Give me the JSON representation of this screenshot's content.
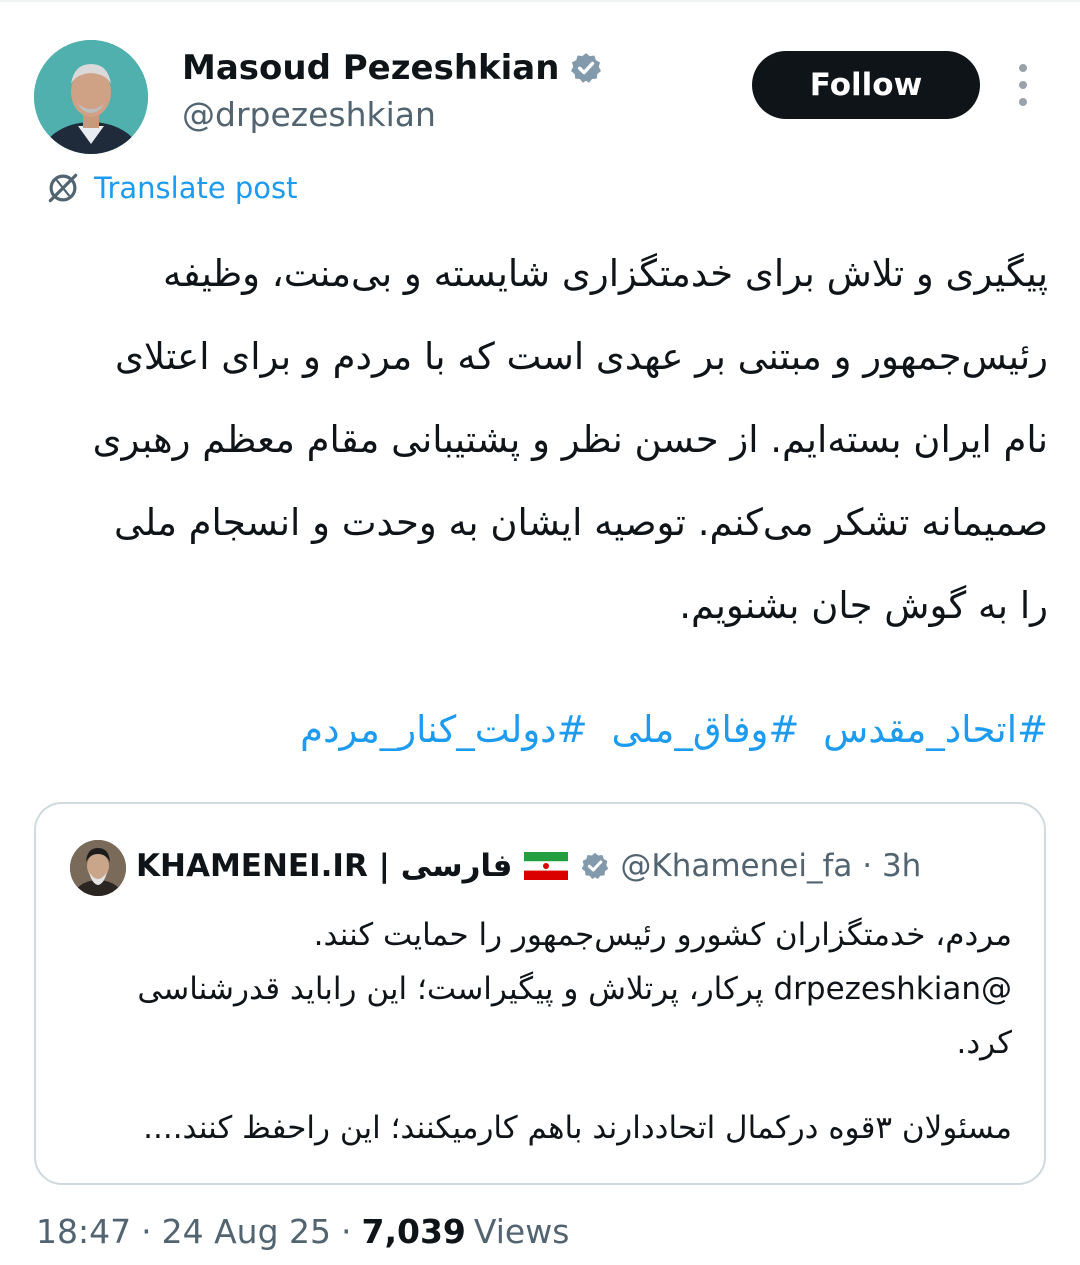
{
  "author": {
    "display_name": "Masoud Pezeshkian",
    "handle": "@drpezeshkian",
    "verified_icon": "verified-badge-icon"
  },
  "actions": {
    "follow_label": "Follow",
    "more_icon": "more-vertical-icon"
  },
  "translate": {
    "label": "Translate post",
    "icon": "translate-globe-icon"
  },
  "post": {
    "lines": [
      "پیگیری و تلاش برای خدمتگزاری شایسته و بی‌منت، وظیفه",
      "رئیس‌جمهور و مبتنی بر عهدی است که با مردم و برای اعتلای",
      "نام ایران بسته‌ایم. از حسن نظر و پشتیبانی مقام معظم رهبری",
      "صمیمانه تشکر می‌کنم. توصیه ایشان به وحدت و انسجام ملی",
      "را به گوش جان بشنویم."
    ],
    "hashtags": [
      "#اتحاد_مقدس",
      "#وفاق_ملی",
      "#دولت_کنار_مردم"
    ]
  },
  "quote": {
    "name": "KHAMENEI.IR | فارسی",
    "handle": "@Khamenei_fa",
    "time": "3h",
    "lines": [
      "مردم، خدمتگزاران کشورو رئیس‌جمهور را حمایت کنند.",
      "@drpezeshkian پرکار، پرتلاش و پیگیراست؛ این راباید قدرشناسی",
      "کرد."
    ],
    "line2": "مسئولان ۳قوه درکمال اتحاددارند باهم کارمیکنند؛ این راحفظ کنند...."
  },
  "meta": {
    "time": "18:47",
    "date": "24 Aug 25",
    "views_count": "7,039",
    "views_label": "Views"
  },
  "colors": {
    "accent": "#1d9bf0",
    "text": "#0f1419",
    "secondary": "#536471",
    "border": "#cfd9de"
  }
}
